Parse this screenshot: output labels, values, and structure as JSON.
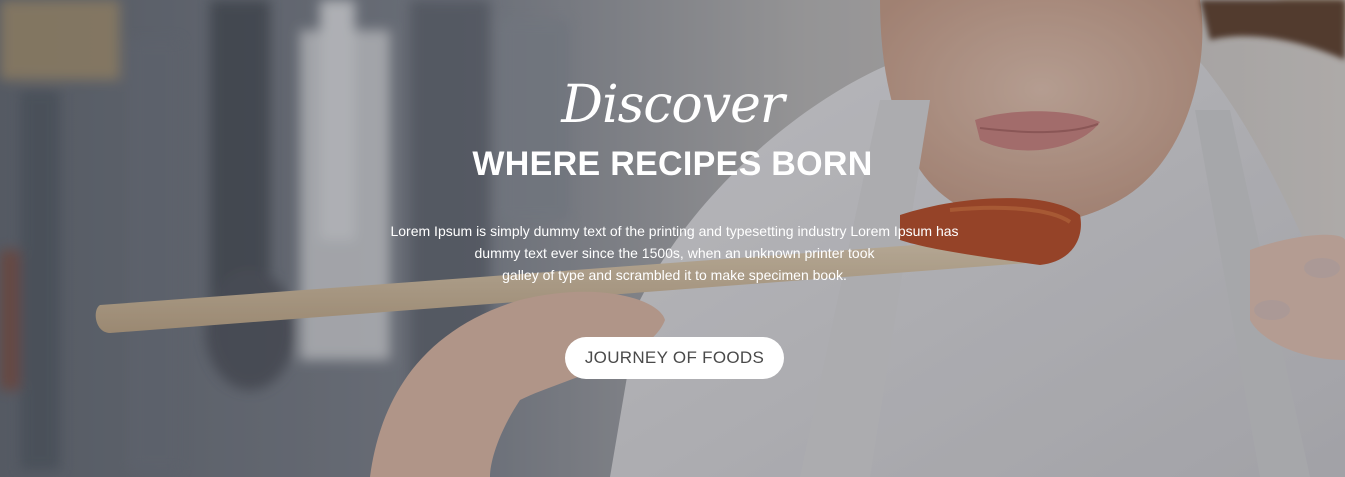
{
  "hero": {
    "script_title": "Discover",
    "main_title": "WHERE RECIPES BORN",
    "description_lines": [
      "Lorem Ipsum is simply dummy text of the printing and typesetting industry Lorem Ipsum has",
      "dummy text ever since the 1500s, when an unknown printer took",
      "galley of type and scrambled it to make specimen book."
    ],
    "cta_label": "JOURNEY OF FOODS",
    "background_image": "chef-tasting-sauce-photo"
  },
  "colors": {
    "text": "#ffffff",
    "button_bg": "#ffffff",
    "button_text": "#4a4a4a",
    "overlay": "rgba(60,60,70,0.28)"
  }
}
